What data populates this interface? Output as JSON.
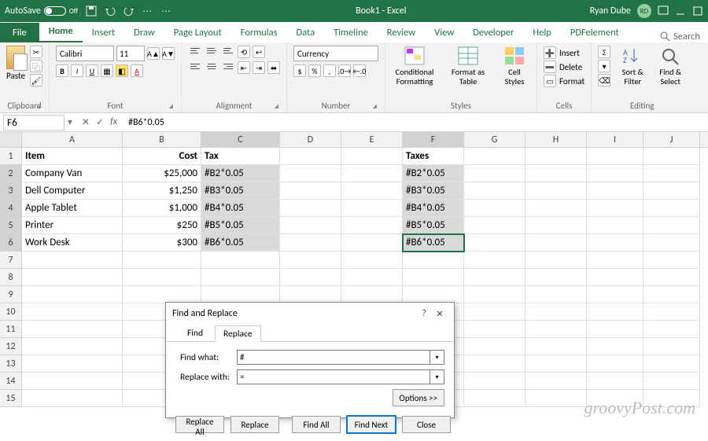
{
  "titlebar": {
    "autosave_label": "AutoSave",
    "autosave_state": "Off",
    "document": "Book1 - Excel",
    "user_name": "Ryan Dube",
    "user_initials": "RD"
  },
  "ribbon_tabs": [
    "File",
    "Home",
    "Insert",
    "Draw",
    "Page Layout",
    "Formulas",
    "Data",
    "Timeline",
    "Review",
    "View",
    "Developer",
    "Help",
    "PDFelement"
  ],
  "active_tab": "Home",
  "search_placeholder": "Search",
  "ribbon": {
    "clipboard": {
      "label": "Clipboard",
      "paste": "Paste"
    },
    "font": {
      "label": "Font",
      "name": "Calibri",
      "size": "11",
      "buttons": {
        "bold": "B",
        "italic": "I",
        "underline": "U"
      }
    },
    "alignment": {
      "label": "Alignment"
    },
    "number": {
      "label": "Number",
      "format": "Currency"
    },
    "styles": {
      "label": "Styles",
      "conditional": "Conditional Formatting",
      "table": "Format as Table",
      "cell": "Cell Styles"
    },
    "cells": {
      "label": "Cells",
      "insert": "Insert",
      "delete": "Delete",
      "format": "Format"
    },
    "editing": {
      "label": "Editing",
      "sort": "Sort & Filter",
      "find": "Find & Select"
    }
  },
  "formula_bar": {
    "namebox": "F6",
    "formula": "#B6*0.05"
  },
  "columns": [
    "A",
    "B",
    "C",
    "D",
    "E",
    "F",
    "G",
    "H",
    "I",
    "J"
  ],
  "sheet": {
    "headers": {
      "A": "Item",
      "B": "Cost",
      "C": "Tax",
      "F": "Taxes"
    },
    "rows": [
      {
        "n": 2,
        "A": "Company Van",
        "B": "$25,000",
        "C": "#B2*0.05",
        "F": "#B2*0.05"
      },
      {
        "n": 3,
        "A": "Dell Computer",
        "B": "$1,250",
        "C": "#B3*0.05",
        "F": "#B3*0.05"
      },
      {
        "n": 4,
        "A": "Apple Tablet",
        "B": "$1,000",
        "C": "#B4*0.05",
        "F": "#B4*0.05"
      },
      {
        "n": 5,
        "A": "Printer",
        "B": "$250",
        "C": "#B5*0.05",
        "F": "#B5*0.05"
      },
      {
        "n": 6,
        "A": "Work Desk",
        "B": "$300",
        "C": "#B6*0.05",
        "F": "#B6*0.05"
      }
    ]
  },
  "dialog": {
    "title": "Find and Replace",
    "tabs": [
      "Find",
      "Replace"
    ],
    "active_tab": "Replace",
    "find_label": "Find what:",
    "find_value": "#",
    "replace_label": "Replace with:",
    "replace_value": "=",
    "options": "Options >>",
    "buttons": {
      "replace_all": "Replace All",
      "replace": "Replace",
      "find_all": "Find All",
      "find_next": "Find Next",
      "close": "Close"
    }
  },
  "watermark": "groovyPost.com"
}
